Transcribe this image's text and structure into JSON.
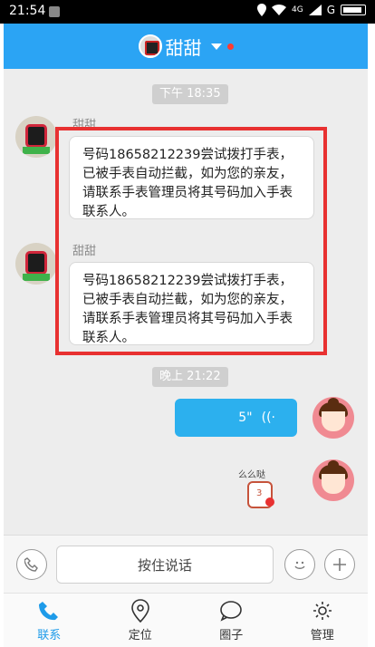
{
  "status_bar": {
    "time": "21:54",
    "network": "4G",
    "signal_label": "G"
  },
  "header": {
    "title": "甜甜"
  },
  "chat": {
    "time_stamps": [
      "下午 18:35",
      "晚上 21:22"
    ],
    "messages": [
      {
        "sender": "甜甜",
        "text": "号码18658212239尝试拨打手表，已被手表自动拦截，如为您的亲友，请联系手表管理员将其号码加入手表联系人。"
      },
      {
        "sender": "甜甜",
        "text": "号码18658212239尝试拨打手表，已被手表自动拦截，如为您的亲友，请联系手表管理员将其号码加入手表联系人。"
      }
    ],
    "voice_message": {
      "duration": "5\""
    },
    "sticker": {
      "text": "么么哒",
      "number": "3"
    }
  },
  "input": {
    "press_to_talk": "按住说话"
  },
  "tabs": [
    {
      "label": "联系",
      "icon": "phone-icon",
      "active": true
    },
    {
      "label": "定位",
      "icon": "location-pin-icon",
      "active": false
    },
    {
      "label": "圈子",
      "icon": "chat-circle-icon",
      "active": false
    },
    {
      "label": "管理",
      "icon": "gear-icon",
      "active": false
    }
  ],
  "colors": {
    "header": "#2ba4f4",
    "voice_bubble": "#2cb0ee",
    "highlight": "#e83131",
    "active_tab": "#1e9be9"
  }
}
